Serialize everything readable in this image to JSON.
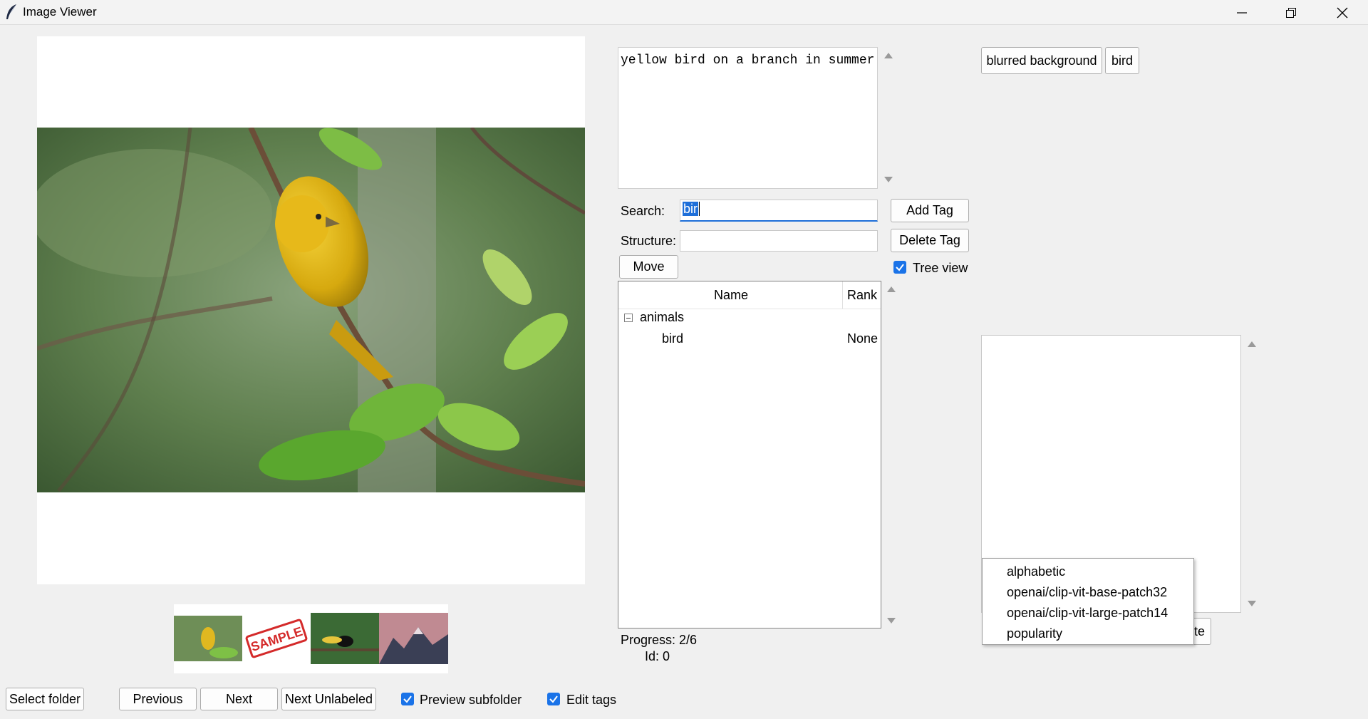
{
  "window": {
    "title": "Image Viewer",
    "controls": {
      "minimize": "minimize-icon",
      "maximize": "restore-icon",
      "close": "close-icon"
    }
  },
  "description": {
    "text": "yellow bird on a branch in summer"
  },
  "form": {
    "search_label": "Search:",
    "search_value": "bir",
    "structure_label": "Structure:",
    "structure_value": "",
    "add_tag_label": "Add Tag",
    "delete_tag_label": "Delete Tag",
    "move_label": "Move",
    "tree_view_label": "Tree view",
    "tree_view_checked": true
  },
  "tree": {
    "columns": [
      "Name",
      "Rank"
    ],
    "rows": [
      {
        "name": "animals",
        "rank": "",
        "expanded": true
      },
      {
        "name": "bird",
        "rank": "None"
      }
    ]
  },
  "status": {
    "progress": "Progress: 2/6",
    "id": "Id: 0"
  },
  "applied_tags": [
    "blurred background",
    "bird"
  ],
  "sort_dropdown": {
    "options": [
      "alphabetic",
      "openai/clip-vit-base-patch32",
      "openai/clip-vit-large-patch14",
      "popularity"
    ],
    "hidden_button_fragment": "te"
  },
  "thumbnails": [
    {
      "name": "yellow-bird-thumbnail"
    },
    {
      "name": "sample-stamp-thumbnail",
      "stamp_text": "SAMPLE"
    },
    {
      "name": "toucan-thumbnail"
    },
    {
      "name": "mountains-thumbnail"
    }
  ],
  "footer": {
    "select_folder": "Select folder",
    "previous": "Previous",
    "next": "Next",
    "next_unlabeled": "Next Unlabeled",
    "preview_subfolder": "Preview subfolder",
    "preview_subfolder_checked": true,
    "edit_tags": "Edit tags",
    "edit_tags_checked": true
  },
  "colors": {
    "window_bg": "#f0f0f0",
    "accent": "#1a73e8",
    "selection": "#1e6fd9"
  }
}
